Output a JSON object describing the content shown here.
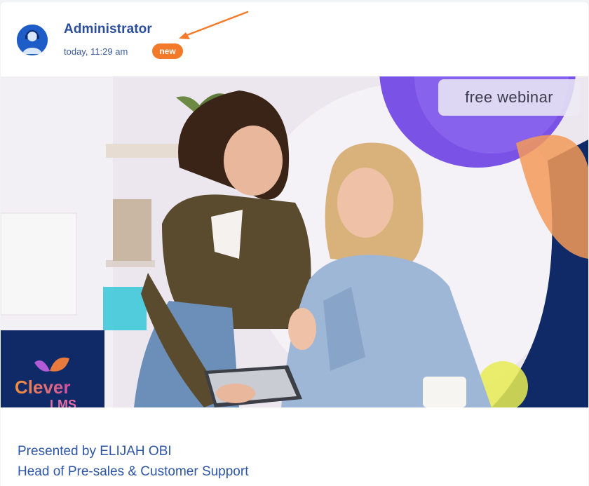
{
  "post": {
    "author": "Administrator",
    "timestamp": "today, 11:29 am",
    "badge": "new"
  },
  "banner": {
    "label": "free webinar",
    "logo_line1": "Clever",
    "logo_line2": "LMS"
  },
  "description": {
    "line1": "Presented by ELIJAH OBI",
    "line2": "Head of Pre-sales & Customer Support"
  },
  "colors": {
    "author": "#2a4e9b",
    "badge": "#f47a2a",
    "avatar": "#1e5cc8",
    "arrow": "#f47a2a",
    "banner_circle": "#7a53e6",
    "banner_navy": "#0f2a66"
  },
  "icons": {
    "avatar": "user-avatar-icon",
    "arrow": "annotation-arrow-icon",
    "logo": "leaf-logo-icon"
  }
}
